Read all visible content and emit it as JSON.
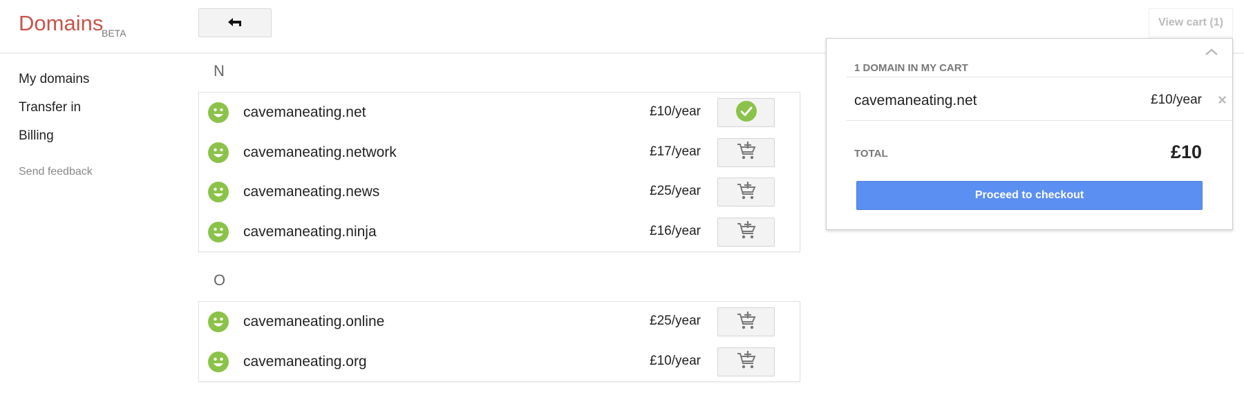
{
  "header": {
    "logo": "Domains",
    "beta": "BETA",
    "back_icon": "back-arrow-icon",
    "view_cart": "View cart (1)"
  },
  "nav": {
    "items": [
      {
        "label": "My domains"
      },
      {
        "label": "Transfer in"
      },
      {
        "label": "Billing"
      }
    ],
    "feedback": "Send feedback"
  },
  "sections": [
    {
      "letter": "N",
      "domains": [
        {
          "name": "cavemaneating.net",
          "price": "£10/year",
          "in_cart": true
        },
        {
          "name": "cavemaneating.network",
          "price": "£17/year",
          "in_cart": false
        },
        {
          "name": "cavemaneating.news",
          "price": "£25/year",
          "in_cart": false
        },
        {
          "name": "cavemaneating.ninja",
          "price": "£16/year",
          "in_cart": false
        }
      ]
    },
    {
      "letter": "O",
      "domains": [
        {
          "name": "cavemaneating.online",
          "price": "£25/year",
          "in_cart": false
        },
        {
          "name": "cavemaneating.org",
          "price": "£10/year",
          "in_cart": false
        }
      ]
    }
  ],
  "cart": {
    "heading": "1 DOMAIN IN MY CART",
    "items": [
      {
        "name": "cavemaneating.net",
        "price": "£10/year"
      }
    ],
    "total_label": "TOTAL",
    "total_value": "£10",
    "checkout_label": "Proceed to checkout"
  },
  "colors": {
    "brand": "#c5554a",
    "available": "#8bc34a",
    "checkout": "#5b8ff1"
  }
}
